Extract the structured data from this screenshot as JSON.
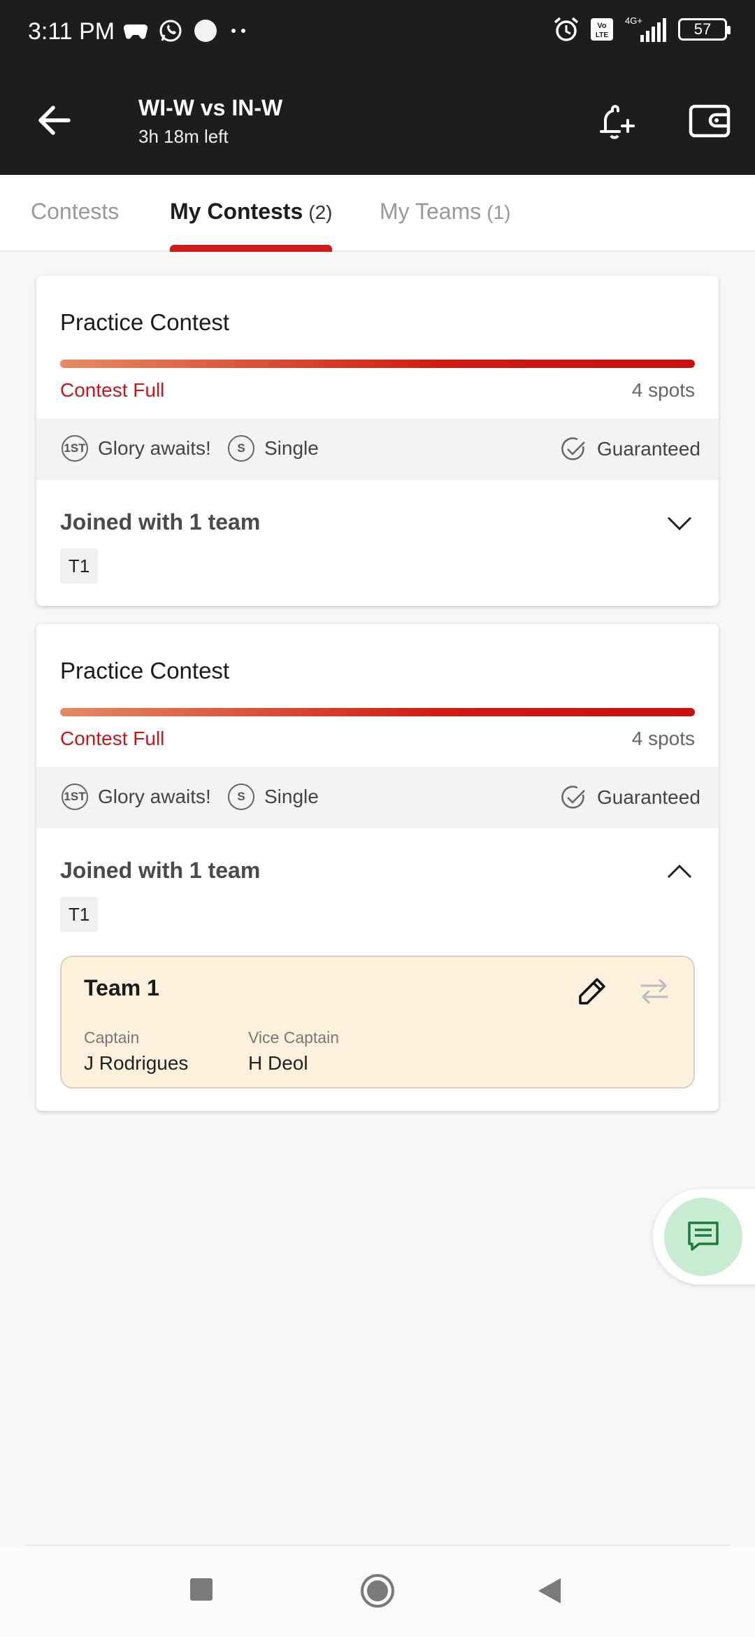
{
  "status_bar": {
    "time": "3:11 PM",
    "network": "4G+",
    "volte": "Vo LTE",
    "battery": "57"
  },
  "header": {
    "title": "WI-W vs IN-W",
    "subtitle": "3h 18m left"
  },
  "tabs": [
    {
      "label": "Contests",
      "count": ""
    },
    {
      "label": "My Contests",
      "count": "(2)"
    },
    {
      "label": "My Teams",
      "count": "(1)"
    }
  ],
  "contests": [
    {
      "title": "Practice Contest",
      "status": "Contest Full",
      "spots": "4 spots",
      "fill_fraction": 1.0,
      "info": {
        "prize": "Glory awaits!",
        "prize_badge": "1ST",
        "entry": "Single",
        "entry_badge": "S",
        "guarantee": "Guaranteed"
      },
      "joined": "Joined with 1 team",
      "team_chip": "T1",
      "expanded": false
    },
    {
      "title": "Practice Contest",
      "status": "Contest Full",
      "spots": "4 spots",
      "fill_fraction": 1.0,
      "info": {
        "prize": "Glory awaits!",
        "prize_badge": "1ST",
        "entry": "Single",
        "entry_badge": "S",
        "guarantee": "Guaranteed"
      },
      "joined": "Joined with 1 team",
      "team_chip": "T1",
      "expanded": true,
      "team": {
        "name": "Team 1",
        "captain_label": "Captain",
        "captain": "J Rodrigues",
        "vice_captain_label": "Vice Captain",
        "vice_captain": "H Deol"
      }
    }
  ],
  "colors": {
    "header_bg": "#1d1d1d",
    "accent_red": "#d11a1a",
    "team_card_bg": "#fdf1dd",
    "fab_bg": "#c7ecd2"
  }
}
